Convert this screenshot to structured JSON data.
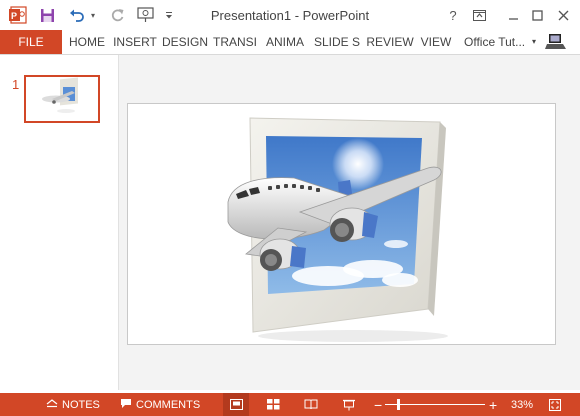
{
  "window": {
    "title": "Presentation1 - PowerPoint"
  },
  "quick_access": {
    "app_icon": "powerpoint-icon",
    "save_icon": "save-icon",
    "undo_icon": "undo-icon",
    "redo_icon": "redo-icon",
    "present_icon": "start-from-beginning-icon",
    "customize_icon": "customize-qat-icon"
  },
  "window_controls": {
    "help": "?",
    "ribbon_options_icon": "ribbon-display-options-icon",
    "minimize_icon": "minimize-icon",
    "maximize_icon": "maximize-icon",
    "close_icon": "close-icon"
  },
  "ribbon": {
    "tabs": [
      {
        "label": "FILE"
      },
      {
        "label": "HOME"
      },
      {
        "label": "INSERT"
      },
      {
        "label": "DESIGN"
      },
      {
        "label": "TRANSI"
      },
      {
        "label": "ANIMA"
      },
      {
        "label": "SLIDE S"
      },
      {
        "label": "REVIEW"
      },
      {
        "label": "VIEW"
      }
    ],
    "account": "Office Tut...",
    "account_dropdown_icon": "chevron-down-icon",
    "account_avatar_icon": "laptop-avatar-icon"
  },
  "slides_pane": {
    "slides": [
      {
        "number": "1"
      }
    ]
  },
  "status_bar": {
    "notes_label": "NOTES",
    "comments_label": "COMMENTS",
    "zoom_percent": "33%",
    "zoom_level": 0.33,
    "views": [
      "normal-view-icon",
      "slide-sorter-icon",
      "reading-view-icon",
      "slideshow-icon"
    ],
    "fit_icon": "fit-slide-icon"
  },
  "colors": {
    "accent": "#d24726",
    "accent_dark": "#b33a1e",
    "sky": "#5a8fd6"
  }
}
